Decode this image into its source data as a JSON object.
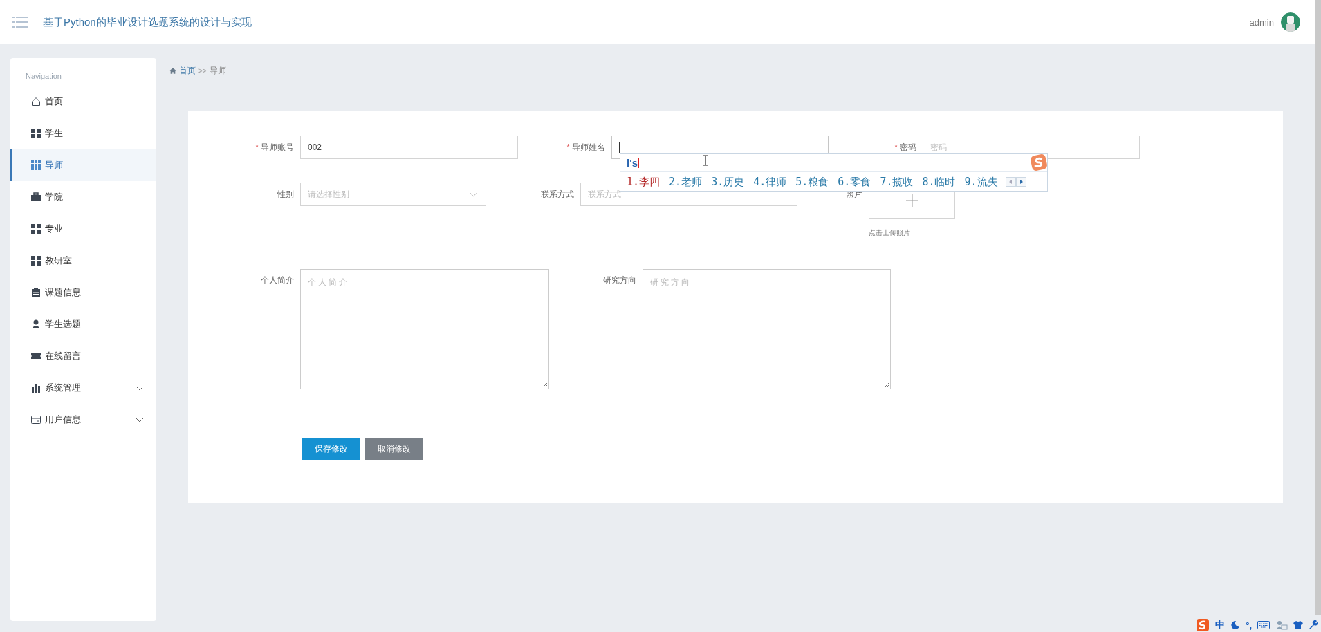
{
  "header": {
    "title": "基于Python的毕业设计选题系统的设计与实现",
    "username": "admin"
  },
  "sidebar": {
    "heading": "Navigation",
    "items": [
      {
        "label": "首页",
        "kind": "link",
        "selected": false
      },
      {
        "label": "学生",
        "kind": "link",
        "selected": false
      },
      {
        "label": "导师",
        "kind": "link",
        "selected": true
      },
      {
        "label": "学院",
        "kind": "link",
        "selected": false
      },
      {
        "label": "专业",
        "kind": "link",
        "selected": false
      },
      {
        "label": "教研室",
        "kind": "link",
        "selected": false
      },
      {
        "label": "课题信息",
        "kind": "link",
        "selected": false
      },
      {
        "label": "学生选题",
        "kind": "link",
        "selected": false
      },
      {
        "label": "在线留言",
        "kind": "link",
        "selected": false
      },
      {
        "label": "系统管理",
        "kind": "group",
        "expanded": false
      },
      {
        "label": "用户信息",
        "kind": "group",
        "expanded": false
      }
    ]
  },
  "breadcrumb": [
    {
      "label": "首页",
      "kind": "link"
    },
    {
      "label": ">>",
      "kind": "separator"
    },
    {
      "label": "导师",
      "kind": "current"
    }
  ],
  "form": {
    "fields": [
      {
        "label": "导师账号",
        "required_mark": "*",
        "kind": "input",
        "value": "002",
        "focused": false
      },
      {
        "label": "导师姓名",
        "required_mark": "*",
        "kind": "input",
        "focused": true
      },
      {
        "label": "密码",
        "required_mark": "*",
        "kind": "input",
        "placeholder": "密码",
        "focused": false
      },
      {
        "label": "性别",
        "kind": "select",
        "placeholder": "请选择性别"
      },
      {
        "label": "联系方式",
        "kind": "input",
        "placeholder": "联系方式",
        "focused": false
      },
      {
        "label": "照片",
        "kind": "upload",
        "hint": "点击上传照片"
      },
      {
        "label": "个人简介",
        "kind": "textarea",
        "placeholder": "个人简介"
      },
      {
        "label": "研究方向",
        "kind": "textarea",
        "placeholder": "研究方向"
      }
    ],
    "buttons": [
      {
        "label": "保存修改",
        "kind": "primary"
      },
      {
        "label": "取消修改",
        "kind": "secondary"
      }
    ]
  },
  "ime_popup": {
    "composition": "l's",
    "candidates": [
      {
        "text": "1.李四",
        "selected": true
      },
      {
        "text": "2.老师",
        "selected": false
      },
      {
        "text": "3.历史",
        "selected": false
      },
      {
        "text": "4.律师",
        "selected": false
      },
      {
        "text": "5.粮食",
        "selected": false
      },
      {
        "text": "6.零食",
        "selected": false
      },
      {
        "text": "7.揽收",
        "selected": false
      },
      {
        "text": "8.临时",
        "selected": false
      },
      {
        "text": "9.流失",
        "selected": false
      }
    ]
  },
  "ime_toolbar": {
    "mode": "中",
    "punctuation": "°,"
  }
}
